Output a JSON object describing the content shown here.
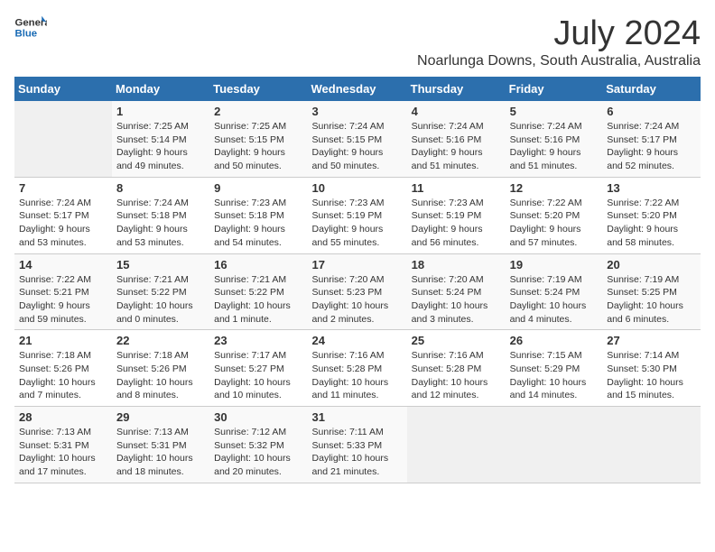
{
  "logo": {
    "line1": "General",
    "line2": "Blue"
  },
  "title": "July 2024",
  "location": "Noarlunga Downs, South Australia, Australia",
  "days_of_week": [
    "Sunday",
    "Monday",
    "Tuesday",
    "Wednesday",
    "Thursday",
    "Friday",
    "Saturday"
  ],
  "weeks": [
    [
      {
        "num": "",
        "info": ""
      },
      {
        "num": "1",
        "info": "Sunrise: 7:25 AM\nSunset: 5:14 PM\nDaylight: 9 hours\nand 49 minutes."
      },
      {
        "num": "2",
        "info": "Sunrise: 7:25 AM\nSunset: 5:15 PM\nDaylight: 9 hours\nand 50 minutes."
      },
      {
        "num": "3",
        "info": "Sunrise: 7:24 AM\nSunset: 5:15 PM\nDaylight: 9 hours\nand 50 minutes."
      },
      {
        "num": "4",
        "info": "Sunrise: 7:24 AM\nSunset: 5:16 PM\nDaylight: 9 hours\nand 51 minutes."
      },
      {
        "num": "5",
        "info": "Sunrise: 7:24 AM\nSunset: 5:16 PM\nDaylight: 9 hours\nand 51 minutes."
      },
      {
        "num": "6",
        "info": "Sunrise: 7:24 AM\nSunset: 5:17 PM\nDaylight: 9 hours\nand 52 minutes."
      }
    ],
    [
      {
        "num": "7",
        "info": "Sunrise: 7:24 AM\nSunset: 5:17 PM\nDaylight: 9 hours\nand 53 minutes."
      },
      {
        "num": "8",
        "info": "Sunrise: 7:24 AM\nSunset: 5:18 PM\nDaylight: 9 hours\nand 53 minutes."
      },
      {
        "num": "9",
        "info": "Sunrise: 7:23 AM\nSunset: 5:18 PM\nDaylight: 9 hours\nand 54 minutes."
      },
      {
        "num": "10",
        "info": "Sunrise: 7:23 AM\nSunset: 5:19 PM\nDaylight: 9 hours\nand 55 minutes."
      },
      {
        "num": "11",
        "info": "Sunrise: 7:23 AM\nSunset: 5:19 PM\nDaylight: 9 hours\nand 56 minutes."
      },
      {
        "num": "12",
        "info": "Sunrise: 7:22 AM\nSunset: 5:20 PM\nDaylight: 9 hours\nand 57 minutes."
      },
      {
        "num": "13",
        "info": "Sunrise: 7:22 AM\nSunset: 5:20 PM\nDaylight: 9 hours\nand 58 minutes."
      }
    ],
    [
      {
        "num": "14",
        "info": "Sunrise: 7:22 AM\nSunset: 5:21 PM\nDaylight: 9 hours\nand 59 minutes."
      },
      {
        "num": "15",
        "info": "Sunrise: 7:21 AM\nSunset: 5:22 PM\nDaylight: 10 hours\nand 0 minutes."
      },
      {
        "num": "16",
        "info": "Sunrise: 7:21 AM\nSunset: 5:22 PM\nDaylight: 10 hours\nand 1 minute."
      },
      {
        "num": "17",
        "info": "Sunrise: 7:20 AM\nSunset: 5:23 PM\nDaylight: 10 hours\nand 2 minutes."
      },
      {
        "num": "18",
        "info": "Sunrise: 7:20 AM\nSunset: 5:24 PM\nDaylight: 10 hours\nand 3 minutes."
      },
      {
        "num": "19",
        "info": "Sunrise: 7:19 AM\nSunset: 5:24 PM\nDaylight: 10 hours\nand 4 minutes."
      },
      {
        "num": "20",
        "info": "Sunrise: 7:19 AM\nSunset: 5:25 PM\nDaylight: 10 hours\nand 6 minutes."
      }
    ],
    [
      {
        "num": "21",
        "info": "Sunrise: 7:18 AM\nSunset: 5:26 PM\nDaylight: 10 hours\nand 7 minutes."
      },
      {
        "num": "22",
        "info": "Sunrise: 7:18 AM\nSunset: 5:26 PM\nDaylight: 10 hours\nand 8 minutes."
      },
      {
        "num": "23",
        "info": "Sunrise: 7:17 AM\nSunset: 5:27 PM\nDaylight: 10 hours\nand 10 minutes."
      },
      {
        "num": "24",
        "info": "Sunrise: 7:16 AM\nSunset: 5:28 PM\nDaylight: 10 hours\nand 11 minutes."
      },
      {
        "num": "25",
        "info": "Sunrise: 7:16 AM\nSunset: 5:28 PM\nDaylight: 10 hours\nand 12 minutes."
      },
      {
        "num": "26",
        "info": "Sunrise: 7:15 AM\nSunset: 5:29 PM\nDaylight: 10 hours\nand 14 minutes."
      },
      {
        "num": "27",
        "info": "Sunrise: 7:14 AM\nSunset: 5:30 PM\nDaylight: 10 hours\nand 15 minutes."
      }
    ],
    [
      {
        "num": "28",
        "info": "Sunrise: 7:13 AM\nSunset: 5:31 PM\nDaylight: 10 hours\nand 17 minutes."
      },
      {
        "num": "29",
        "info": "Sunrise: 7:13 AM\nSunset: 5:31 PM\nDaylight: 10 hours\nand 18 minutes."
      },
      {
        "num": "30",
        "info": "Sunrise: 7:12 AM\nSunset: 5:32 PM\nDaylight: 10 hours\nand 20 minutes."
      },
      {
        "num": "31",
        "info": "Sunrise: 7:11 AM\nSunset: 5:33 PM\nDaylight: 10 hours\nand 21 minutes."
      },
      {
        "num": "",
        "info": ""
      },
      {
        "num": "",
        "info": ""
      },
      {
        "num": "",
        "info": ""
      }
    ]
  ]
}
